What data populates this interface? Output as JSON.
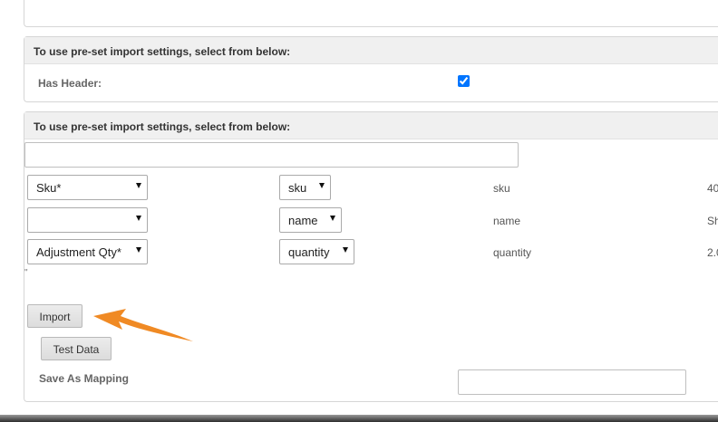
{
  "settings_panel": {
    "title": "To use pre-set import settings, select from below:",
    "has_header_label": "Has Header:",
    "has_header_checked": true
  },
  "mapping_panel": {
    "title": "To use pre-set import settings, select from below:",
    "rows": [
      {
        "field_select": "Sku*",
        "column_select": "sku",
        "column_name": "sku",
        "sample": "40"
      },
      {
        "field_select": "",
        "column_select": "name",
        "column_name": "name",
        "sample": "Sh"
      },
      {
        "field_select": "Adjustment Qty*",
        "column_select": "quantity",
        "column_name": "quantity",
        "sample": "2.0"
      }
    ],
    "stray_mark": "\"",
    "import_button": "Import",
    "test_data_button": "Test Data",
    "save_mapping_label": "Save As Mapping",
    "save_mapping_value": ""
  },
  "annotation": {
    "arrow_color": "#f08a24"
  }
}
